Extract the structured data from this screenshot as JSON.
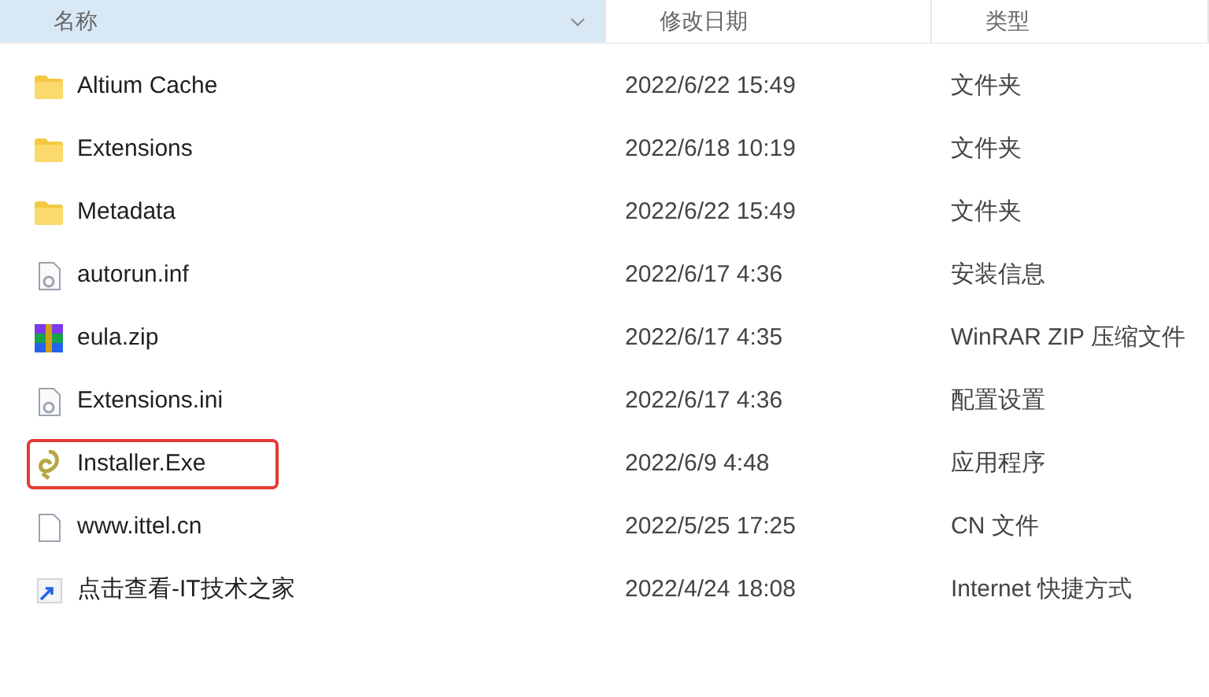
{
  "columns": [
    {
      "label": "名称",
      "selected": true
    },
    {
      "label": "修改日期",
      "selected": false
    },
    {
      "label": "类型",
      "selected": false
    }
  ],
  "rows": [
    {
      "name": "Altium Cache",
      "kind": "folder",
      "date": "2022/6/22 15:49",
      "type": "文件夹",
      "highlighted": false
    },
    {
      "name": "Extensions",
      "kind": "folder",
      "date": "2022/6/18 10:19",
      "type": "文件夹",
      "highlighted": false
    },
    {
      "name": "Metadata",
      "kind": "folder",
      "date": "2022/6/22 15:49",
      "type": "文件夹",
      "highlighted": false
    },
    {
      "name": "autorun.inf",
      "kind": "config",
      "date": "2022/6/17 4:36",
      "type": "安装信息",
      "highlighted": false
    },
    {
      "name": "eula.zip",
      "kind": "archive",
      "date": "2022/6/17 4:35",
      "type": "WinRAR ZIP 压缩文件",
      "highlighted": false
    },
    {
      "name": "Extensions.ini",
      "kind": "config",
      "date": "2022/6/17 4:36",
      "type": "配置设置",
      "highlighted": false
    },
    {
      "name": "Installer.Exe",
      "kind": "exe",
      "date": "2022/6/9 4:48",
      "type": "应用程序",
      "highlighted": true
    },
    {
      "name": "www.ittel.cn",
      "kind": "file",
      "date": "2022/5/25 17:25",
      "type": "CN 文件",
      "highlighted": false
    },
    {
      "name": "点击查看-IT技术之家",
      "kind": "shortcut",
      "date": "2022/4/24 18:08",
      "type": "Internet 快捷方式",
      "highlighted": false
    }
  ]
}
